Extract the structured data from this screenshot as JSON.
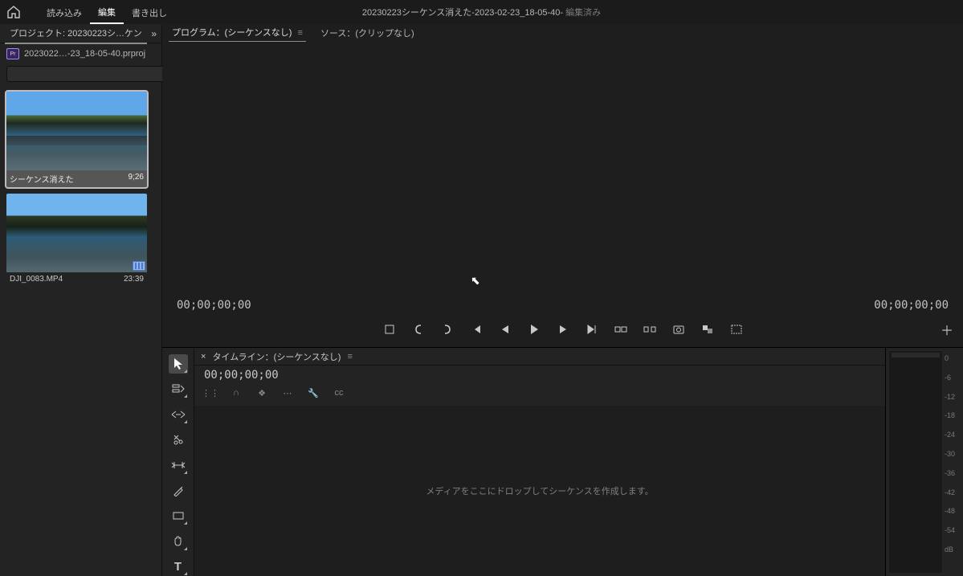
{
  "top": {
    "tabs": [
      "読み込み",
      "編集",
      "書き出し"
    ],
    "activeTab": 1,
    "title_main": "20230223シーケンス消えた-2023-02-23_18-05-40- ",
    "title_suffix": "編集済み"
  },
  "project": {
    "tab_label": "プロジェクト: 20230223シ…ケン",
    "file_line": "2023022…-23_18-05-40.prproj",
    "pr_badge_text": "Pr",
    "search_placeholder": "",
    "filter_glyph": "▸◂",
    "clips": [
      {
        "name": "シーケンス消えた",
        "duration": "9;26",
        "selected": true,
        "has_badge": false
      },
      {
        "name": "DJI_0083.MP4",
        "duration": "23:39",
        "selected": false,
        "has_badge": true
      }
    ]
  },
  "program": {
    "tab_active": "プログラム：(シーケンスなし)",
    "tab_active_menu": "≡",
    "tab_inactive": "ソース：(クリップなし)",
    "tc_left": "00;00;00;00",
    "tc_right": "00;00;00;00",
    "transport_icons": [
      "mark-clip",
      "mark-in",
      "mark-out",
      "go-in",
      "step-back",
      "play",
      "step-fwd",
      "go-out",
      "lift",
      "extract",
      "snapshot",
      "safe-margins",
      "trim"
    ]
  },
  "tools": [
    {
      "name": "selection-tool",
      "glyph": "▲",
      "active": true
    },
    {
      "name": "track-select-tool",
      "glyph": "⇥"
    },
    {
      "name": "ripple-edit-tool",
      "glyph": "⇆"
    },
    {
      "name": "razor-tool",
      "glyph": "✂"
    },
    {
      "name": "slip-tool",
      "glyph": "↔"
    },
    {
      "name": "pen-tool",
      "glyph": "✎"
    },
    {
      "name": "rectangle-tool",
      "glyph": "▭"
    },
    {
      "name": "hand-tool",
      "glyph": "✋"
    },
    {
      "name": "type-tool",
      "glyph": "T"
    }
  ],
  "timeline": {
    "close_glyph": "×",
    "tab_label": "タイムライン：(シーケンスなし)",
    "menu_glyph": "≡",
    "tc": "00;00;00;00",
    "mini_btns": [
      "⋮⋮",
      "∩",
      "❖",
      "⋯",
      "🔧",
      "cc"
    ],
    "drop_hint": "メディアをここにドロップしてシーケンスを作成します。"
  },
  "audio_meter": {
    "scale": [
      "0",
      "-6",
      "-12",
      "-18",
      "-24",
      "-30",
      "-36",
      "-42",
      "-48",
      "-54",
      "dB"
    ]
  }
}
